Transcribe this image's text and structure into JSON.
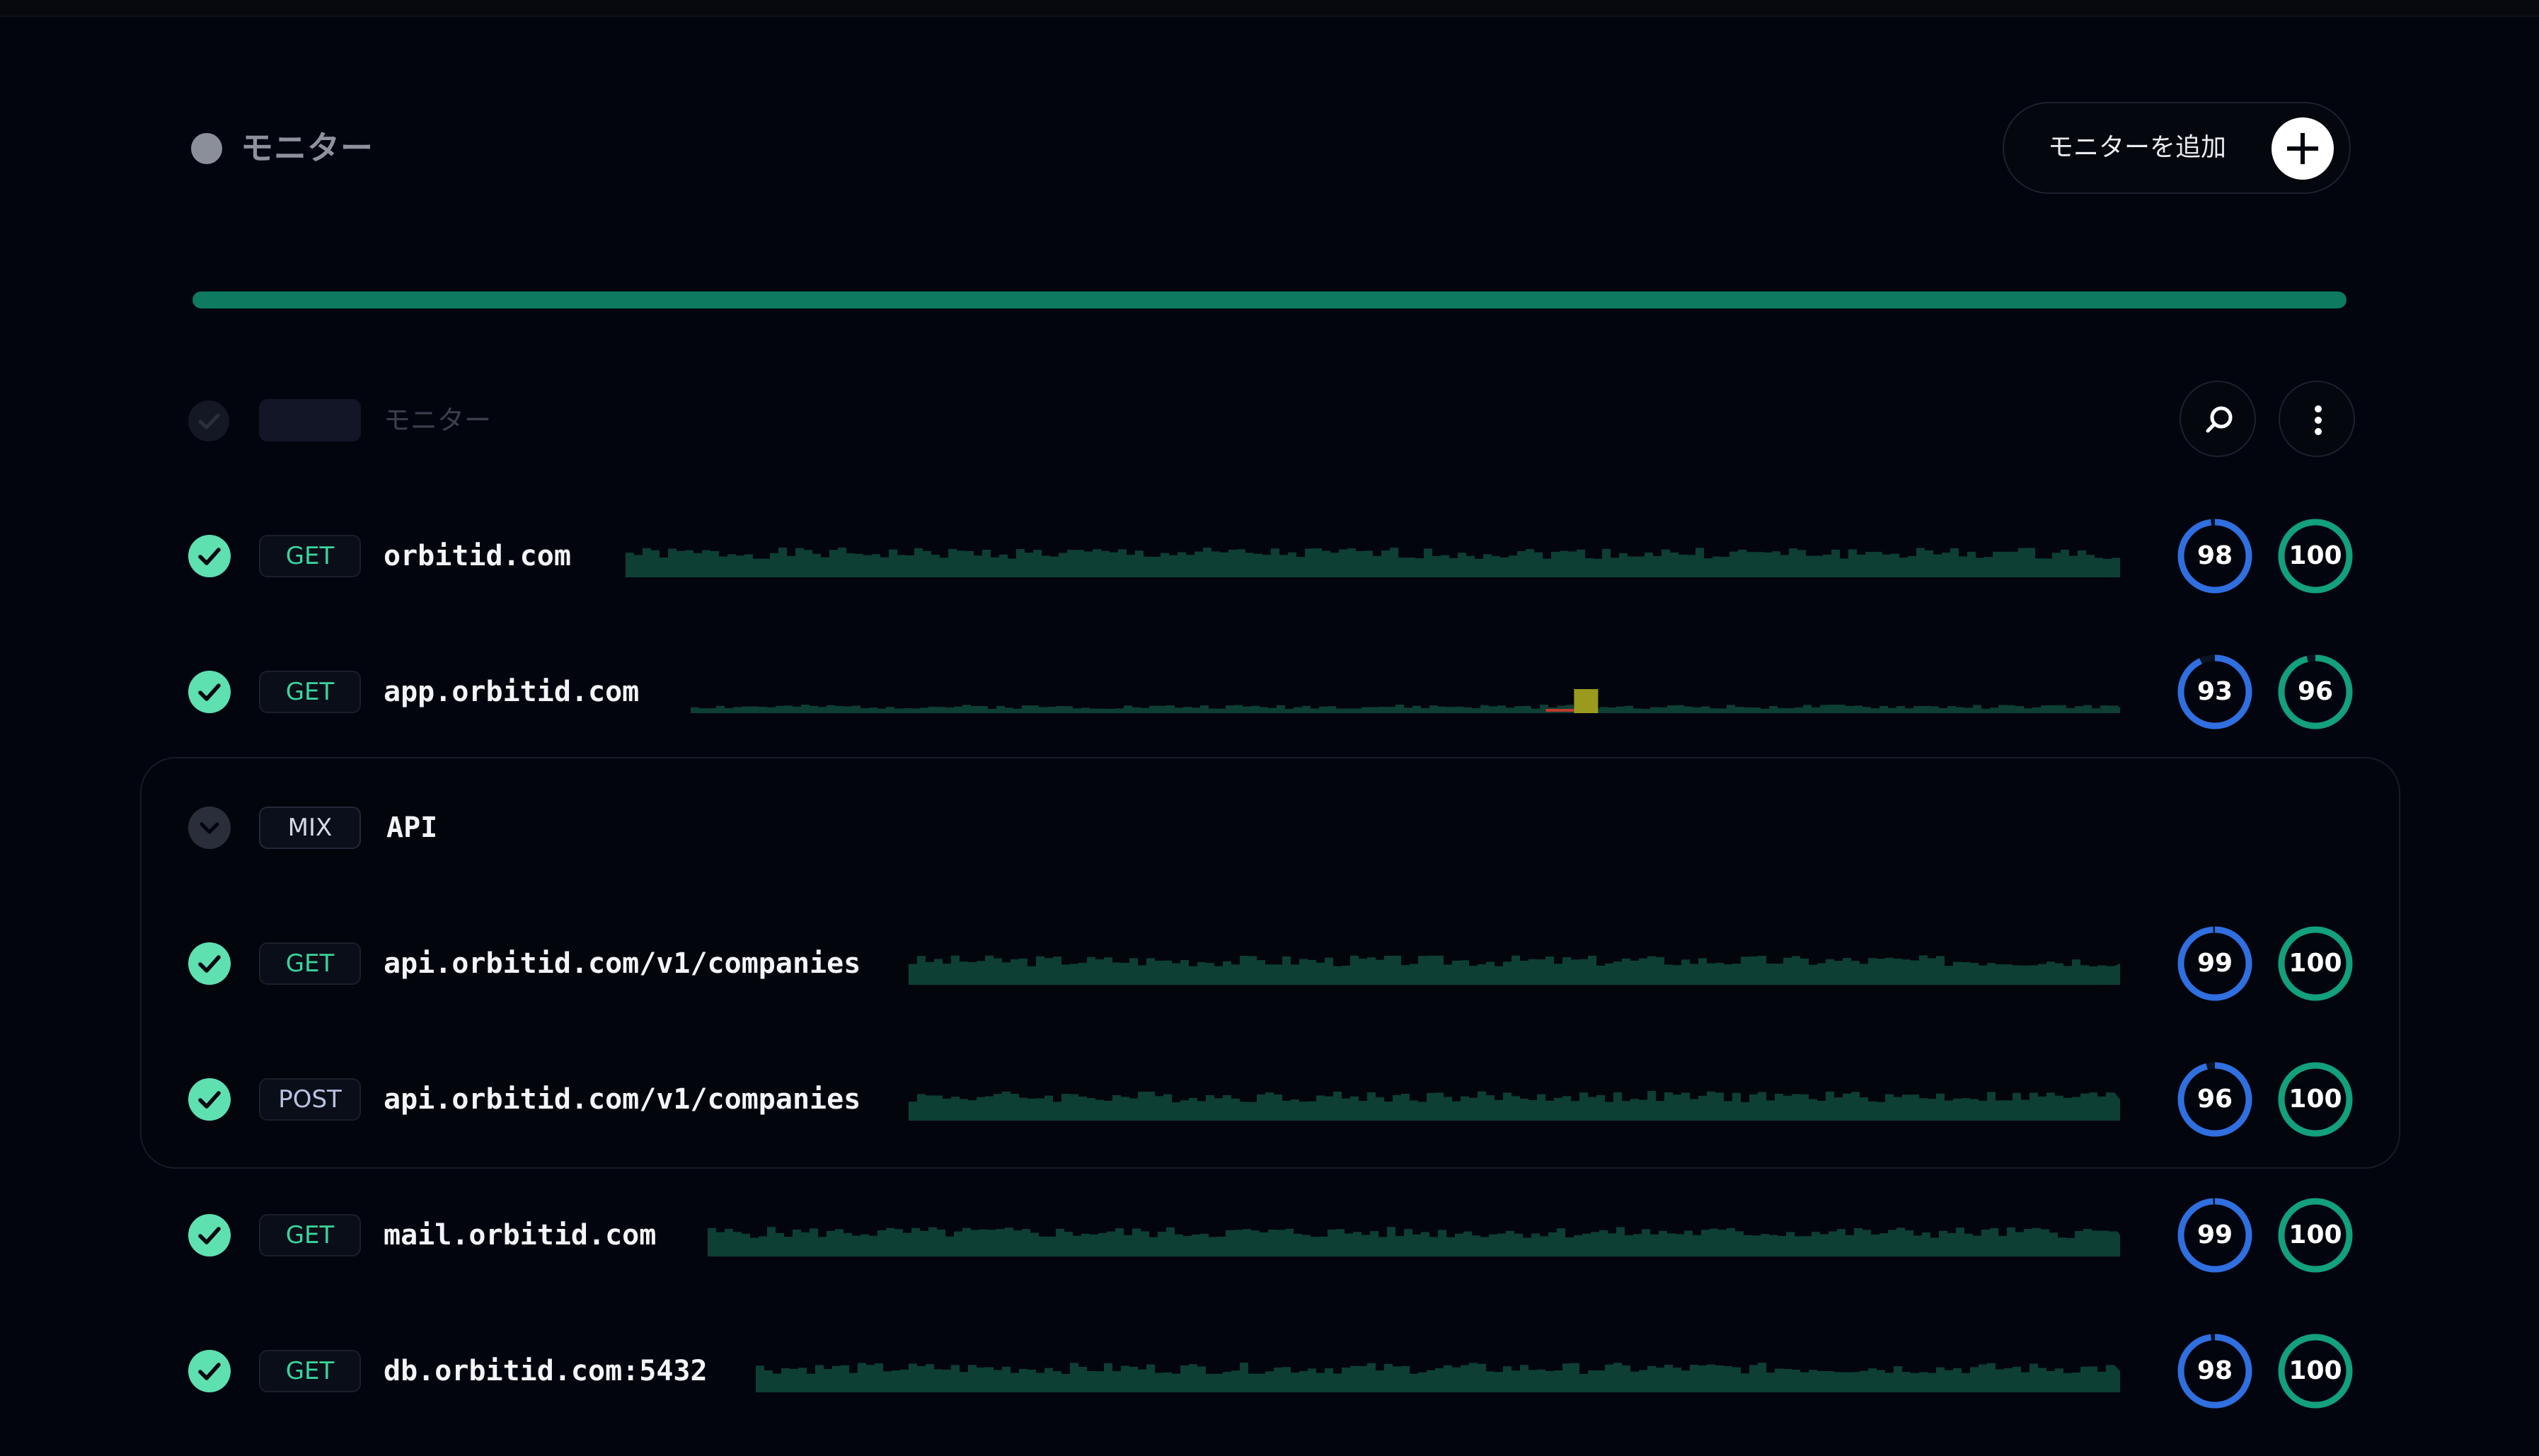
{
  "header": {
    "title": "モニター",
    "add_button_label": "モニターを追加",
    "status_dot_color": "#8b8f9a",
    "overall_progress_pct": 100
  },
  "toolbar": {
    "filter_label": "モニター",
    "search_icon": "search-icon",
    "more_icon": "more-vertical-icon"
  },
  "colors": {
    "ok": "#5ee0b0",
    "method_get": "#3cd39c",
    "ring_blue": "#2f6fe0",
    "ring_green": "#13a07c",
    "spark": "#0d3f34",
    "spark_warning": "#9a9a1e",
    "spark_error": "#c0392b"
  },
  "monitors": [
    {
      "method": "GET",
      "name": "orbitid.com",
      "score_a": 98,
      "score_b": 100
    },
    {
      "method": "GET",
      "name": "app.orbitid.com",
      "score_a": 93,
      "score_b": 96
    }
  ],
  "group": {
    "method": "MIX",
    "name": "API",
    "monitors": [
      {
        "method": "GET",
        "name": "api.orbitid.com/v1/companies",
        "score_a": 99,
        "score_b": 100
      },
      {
        "method": "POST",
        "name": "api.orbitid.com/v1/companies",
        "score_a": 96,
        "score_b": 100
      }
    ]
  },
  "monitors_after": [
    {
      "method": "GET",
      "name": "mail.orbitid.com",
      "score_a": 99,
      "score_b": 100
    },
    {
      "method": "GET",
      "name": "db.orbitid.com:5432",
      "score_a": 98,
      "score_b": 100
    }
  ]
}
